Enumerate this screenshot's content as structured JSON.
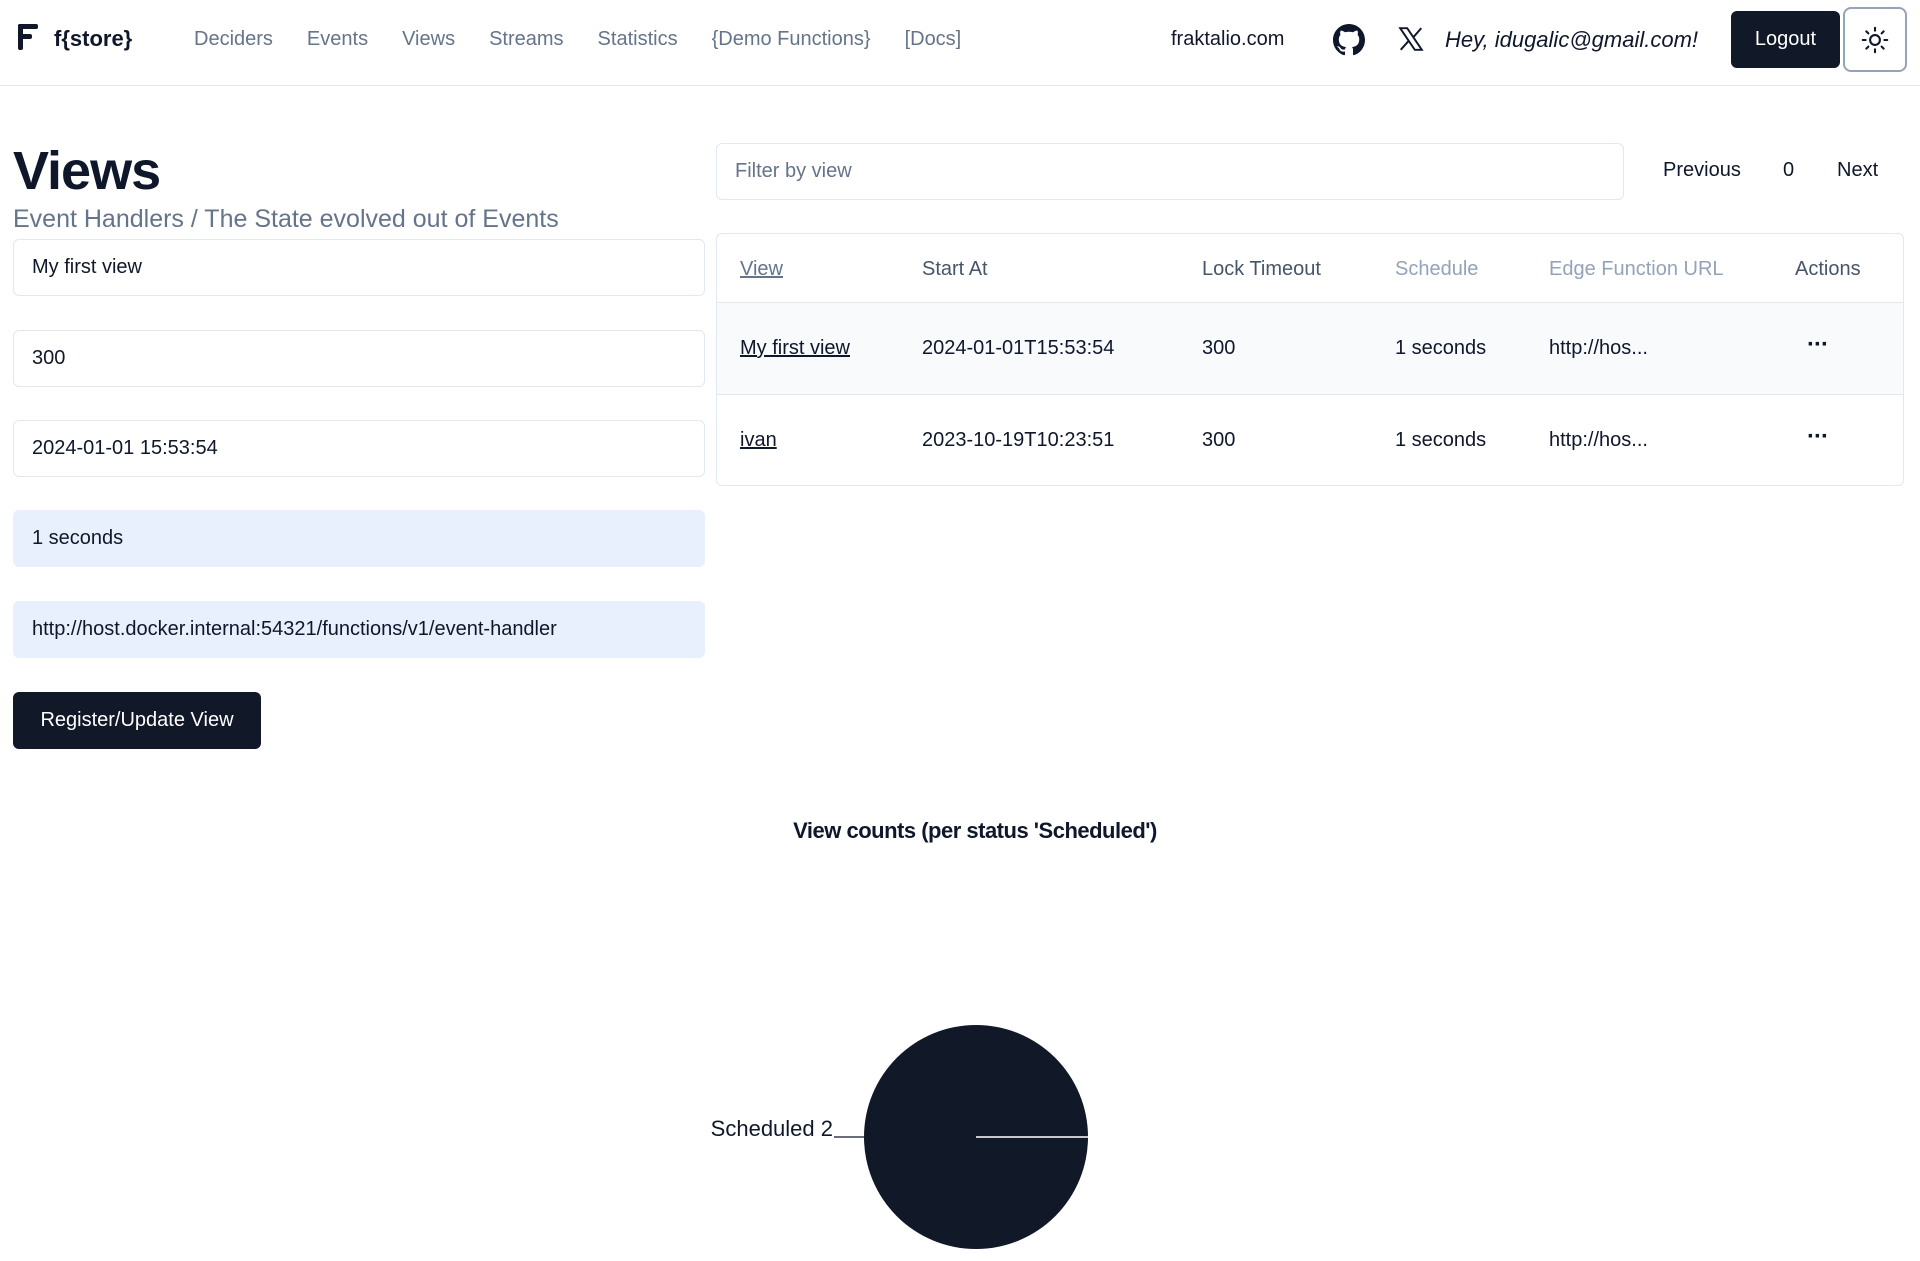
{
  "header": {
    "brand": "f{store}",
    "nav": [
      "Deciders",
      "Events",
      "Views",
      "Streams",
      "Statistics",
      "{Demo Functions}",
      "[Docs]"
    ],
    "site_link": "fraktalio.com",
    "greeting": "Hey, idugalic@gmail.com!",
    "logout_label": "Logout"
  },
  "form": {
    "title": "Views",
    "subtitle": "Event Handlers / The State evolved out of Events",
    "view_name": "My first view",
    "lock_timeout": "300",
    "start_at": "2024-01-01 15:53:54",
    "schedule": "1 seconds",
    "edge_function_url": "http://host.docker.internal:54321/functions/v1/event-handler",
    "submit_label": "Register/Update View"
  },
  "list": {
    "filter_placeholder": "Filter by view",
    "previous_label": "Previous",
    "page": "0",
    "next_label": "Next",
    "columns": [
      "View",
      "Start At",
      "Lock Timeout",
      "Schedule",
      "Edge Function URL",
      "Actions"
    ],
    "rows": [
      {
        "view": "My first view",
        "start_at": "2024-01-01T15:53:54",
        "lock_timeout": "300",
        "schedule": "1 seconds",
        "url": "http://hos...",
        "actions": "···"
      },
      {
        "view": "ivan",
        "start_at": "2023-10-19T10:23:51",
        "lock_timeout": "300",
        "schedule": "1 seconds",
        "url": "http://hos...",
        "actions": "···"
      }
    ]
  },
  "chart_data": {
    "type": "pie",
    "title": "View counts (per status 'Scheduled')",
    "categories": [
      "Scheduled"
    ],
    "values": [
      2
    ],
    "labels": [
      "Scheduled 2"
    ],
    "colors": [
      "#111827"
    ]
  }
}
